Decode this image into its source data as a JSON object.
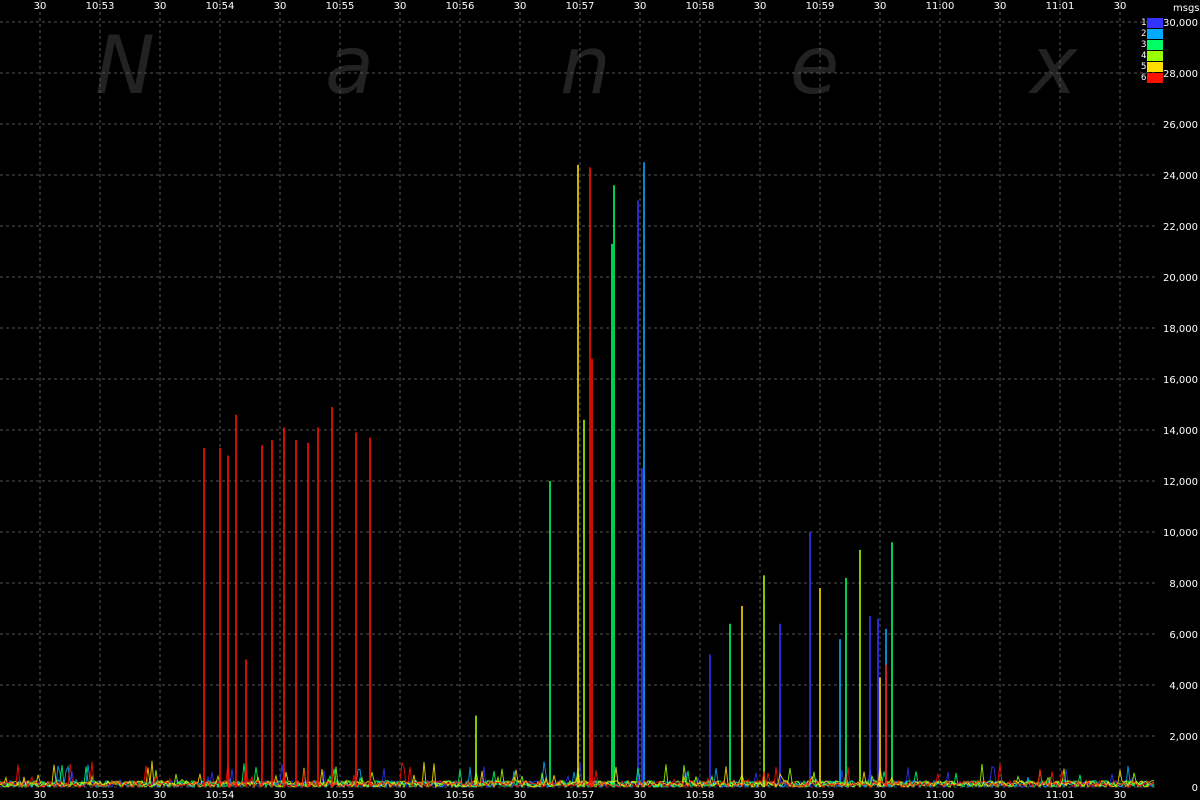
{
  "watermark": [
    "N",
    "a",
    "n",
    "e",
    "x"
  ],
  "colors": {
    "background": "#000000",
    "grid": "#555555",
    "text": "#ffffff",
    "series": [
      "#3333ff",
      "#00aaff",
      "#00ff66",
      "#99ff00",
      "#ffdd00",
      "#ff1100"
    ]
  },
  "chart_data": {
    "type": "line",
    "unit_label": "msgs",
    "x_time_labels": [
      "30",
      "10:53",
      "30",
      "10:54",
      "30",
      "10:55",
      "30",
      "10:56",
      "30",
      "10:57",
      "30",
      "10:58",
      "30",
      "10:59",
      "30",
      "11:00",
      "30",
      "11:01",
      "30"
    ],
    "y_ticks": [
      0,
      2000,
      4000,
      6000,
      8000,
      10000,
      12000,
      14000,
      16000,
      18000,
      20000,
      22000,
      24000,
      26000,
      28000,
      30000
    ],
    "y_tick_labels": [
      "0",
      "2,000",
      "4,000",
      "6,000",
      "8,000",
      "10,000",
      "12,000",
      "14,000",
      "16,000",
      "18,000",
      "20,000",
      "22,000",
      "24,000",
      "26,000",
      "28,000",
      "30,000"
    ],
    "ylim": [
      0,
      30000
    ],
    "xlim": [
      "10:52:30",
      "11:01:47"
    ],
    "grid": true,
    "legend_position": "top-right",
    "series": [
      {
        "name": "1",
        "color": "#3333ff",
        "spikes": [
          [
            "10:57:29",
            23000
          ],
          [
            "10:57:31",
            12500
          ],
          [
            "10:58:05",
            5200
          ],
          [
            "10:58:40",
            6400
          ],
          [
            "10:58:55",
            10000
          ],
          [
            "10:59:25",
            6700
          ],
          [
            "10:59:29",
            6600
          ]
        ]
      },
      {
        "name": "2",
        "color": "#00aaff",
        "spikes": [
          [
            "10:57:32",
            24500
          ],
          [
            "10:59:10",
            5800
          ],
          [
            "10:59:33",
            6200
          ]
        ]
      },
      {
        "name": "3",
        "color": "#00ff66",
        "spikes": [
          [
            "10:56:45",
            12000
          ],
          [
            "10:57:16",
            21300
          ],
          [
            "10:57:17",
            23600
          ],
          [
            "10:58:15",
            6400
          ],
          [
            "10:59:13",
            8200
          ],
          [
            "10:59:36",
            9600
          ]
        ]
      },
      {
        "name": "4",
        "color": "#99ff00",
        "spikes": [
          [
            "10:56:08",
            2800
          ],
          [
            "10:57:02",
            14400
          ],
          [
            "10:58:32",
            8300
          ],
          [
            "10:59:20",
            9300
          ]
        ]
      },
      {
        "name": "5",
        "color": "#ffdd00",
        "spikes": [
          [
            "10:56:59",
            24400
          ],
          [
            "10:58:21",
            7100
          ],
          [
            "10:59:00",
            7800
          ],
          [
            "10:59:30",
            4300
          ]
        ]
      },
      {
        "name": "6",
        "color": "#ff1100",
        "spikes": [
          [
            "10:53:52",
            13300
          ],
          [
            "10:54:00",
            13300
          ],
          [
            "10:54:04",
            13000
          ],
          [
            "10:54:08",
            14600
          ],
          [
            "10:54:13",
            5000
          ],
          [
            "10:54:21",
            13400
          ],
          [
            "10:54:26",
            13600
          ],
          [
            "10:54:32",
            14100
          ],
          [
            "10:54:38",
            13600
          ],
          [
            "10:54:44",
            13500
          ],
          [
            "10:54:49",
            14100
          ],
          [
            "10:54:56",
            14900
          ],
          [
            "10:55:08",
            13900
          ],
          [
            "10:55:15",
            13700
          ],
          [
            "10:57:05",
            24300
          ],
          [
            "10:57:06",
            16800
          ],
          [
            "10:59:33",
            4800
          ]
        ]
      }
    ]
  }
}
